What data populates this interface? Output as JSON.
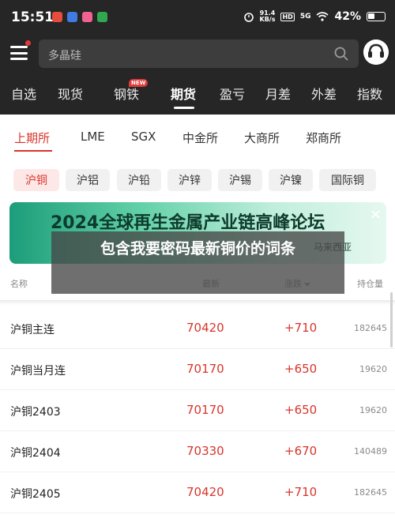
{
  "status_bar": {
    "time": "15:51",
    "net_speed_value": "91.4",
    "net_speed_unit": "KB/s",
    "hd": "HD",
    "signal": "5G",
    "battery": "42%"
  },
  "header": {
    "search_placeholder": "多晶硅",
    "nav": [
      {
        "label": "自选"
      },
      {
        "label": "现货"
      },
      {
        "label": "钢铁",
        "badge": "NEW"
      },
      {
        "label": "期货",
        "active": true
      },
      {
        "label": "盈亏"
      },
      {
        "label": "月差"
      },
      {
        "label": "外差"
      },
      {
        "label": "指数"
      }
    ]
  },
  "exchange_tabs": [
    "上期所",
    "LME",
    "SGX",
    "中金所",
    "大商所",
    "郑商所"
  ],
  "chips": [
    "沪铜",
    "沪铝",
    "沪铅",
    "沪锌",
    "沪锡",
    "沪镍",
    "国际铜"
  ],
  "banner": {
    "title": "2024全球再生金属产业链高峰论坛",
    "subtitle": "马来西亚",
    "close": "✕"
  },
  "columns": {
    "name": "名称",
    "latest": "最新",
    "change": "涨跌",
    "open_interest": "持仓量"
  },
  "rows": [
    {
      "name": "沪铜主连",
      "price": "70420",
      "change": "+710",
      "oi": "182645"
    },
    {
      "name": "沪铜当月连",
      "price": "70170",
      "change": "+650",
      "oi": "19620"
    },
    {
      "name": "沪铜2403",
      "price": "70170",
      "change": "+650",
      "oi": "19620"
    },
    {
      "name": "沪铜2404",
      "price": "70330",
      "change": "+670",
      "oi": "140489"
    },
    {
      "name": "沪铜2405",
      "price": "70420",
      "change": "+710",
      "oi": "182645"
    }
  ],
  "overlay": {
    "text": "包含我要密码最新铜价的词条"
  },
  "colors": {
    "header_bg": "#262626",
    "accent_red": "#d8342b",
    "banner_green": "#1c9d7a"
  }
}
